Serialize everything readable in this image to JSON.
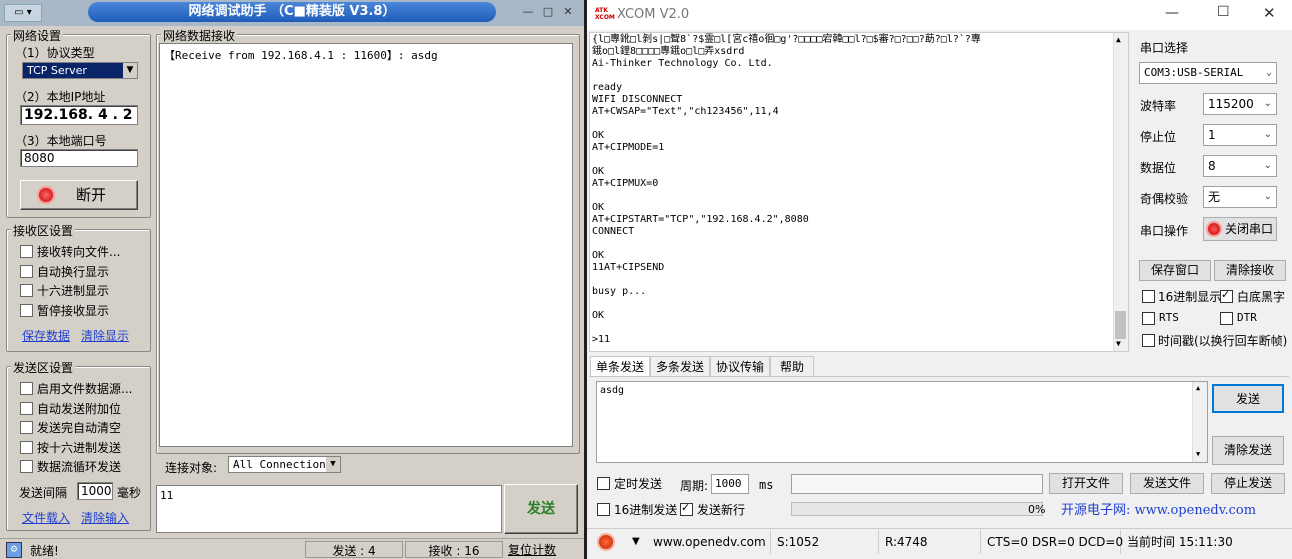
{
  "netassist": {
    "title": "网络调试助手 （C■精装版 V3.8）",
    "net_group": {
      "legend": "网络设置",
      "protocol_label": "（1）协议类型",
      "protocol_value": "TCP Server",
      "ip_label": "（2）本地IP地址",
      "ip_value": "192.168. 4 . 2",
      "port_label": "（3）本地端口号",
      "port_value": "8080",
      "disconnect_label": "断开"
    },
    "recv_group": {
      "legend": "接收区设置",
      "options": [
        "接收转向文件...",
        "自动换行显示",
        "十六进制显示",
        "暂停接收显示"
      ],
      "save_link": "保存数据",
      "clear_link": "清除显示"
    },
    "send_group": {
      "legend": "发送区设置",
      "options": [
        "启用文件数据源...",
        "自动发送附加位",
        "发送完自动清空",
        "按十六进制发送",
        "数据流循环发送"
      ],
      "interval_label": "发送间隔",
      "interval_value": "1000",
      "interval_unit": "毫秒",
      "load_link": "文件载入",
      "clear_link": "清除输入"
    },
    "data_group": {
      "legend": "网络数据接收",
      "received_text": "【Receive from 192.168.4.1 : 11600】: asdg"
    },
    "target": {
      "label": "连接对象:",
      "value": "All Connections"
    },
    "send_text": "11",
    "send_button": "发送",
    "status": {
      "ready": "就绪!",
      "sent": "发送 : 4",
      "recv": "接收 : 16",
      "reset": "复位计数"
    }
  },
  "xcom": {
    "title": "XCOM V2.0",
    "logo": "ATK XCOM",
    "log_lines": [
      "{l□專鈋□l剝s|□聟8`?$霊□l[宮c禧o徊□g'?□□□□宕韓□□l?□$審?□?□□?莇?□l?`?專",
      "鋨o□l鋰8□□□□專鋨o□l□弄xsdrd",
      "Ai-Thinker Technology Co. Ltd.",
      "",
      "ready",
      "WIFI DISCONNECT",
      "AT+CWSAP=\"Text\",\"ch123456\",11,4",
      "",
      "OK",
      "AT+CIPMODE=1",
      "",
      "OK",
      "AT+CIPMUX=0",
      "",
      "OK",
      "AT+CIPSTART=\"TCP\",\"192.168.4.2\",8080",
      "CONNECT",
      "",
      "OK",
      "11AT+CIPSEND",
      "",
      "busy p...",
      "",
      "OK",
      "",
      ">11"
    ],
    "side": {
      "port_select_label": "串口选择",
      "port_value": "COM3:USB-SERIAL",
      "baud_label": "波特率",
      "baud_value": "115200",
      "stop_label": "停止位",
      "stop_value": "1",
      "data_label": "数据位",
      "data_value": "8",
      "parity_label": "奇偶校验",
      "parity_value": "无",
      "op_label": "串口操作",
      "close_port": "关闭串口",
      "save_window": "保存窗口",
      "clear_recv": "清除接收",
      "hex_display": "16进制显示",
      "white_black": "白底黑字",
      "rts": "RTS",
      "dtr": "DTR",
      "timestamp": "时间戳(以换行回车断帧)"
    },
    "tabs": [
      "单条发送",
      "多条发送",
      "协议传输",
      "帮助"
    ],
    "send_text": "asdg",
    "send_button": "发送",
    "clear_send": "清除发送",
    "timed_send": "定时发送",
    "period_label": "周期:",
    "period_value": "1000",
    "period_unit": "ms",
    "open_file": "打开文件",
    "send_file": "发送文件",
    "stop_send": "停止发送",
    "hex_send": "16进制发送",
    "send_newline": "发送新行",
    "progress_text": "0%",
    "progress_value": 0,
    "site_text": "开源电子网: www.openedv.com",
    "status": {
      "url": "www.openedv.com",
      "s": "S:1052",
      "r": "R:4748",
      "lines": "CTS=0 DSR=0 DCD=0",
      "time": "当前时间 15:11:30"
    }
  }
}
